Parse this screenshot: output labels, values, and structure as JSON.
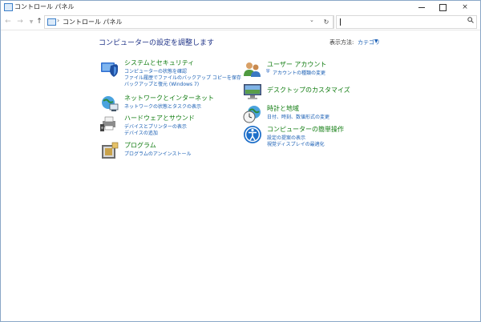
{
  "window": {
    "title": "コントロール パネル",
    "controls": {
      "minimize": "minimize",
      "maximize": "maximize",
      "close": "×"
    }
  },
  "address_bar": {
    "path": "コントロール パネル",
    "separator": "›",
    "search_value": ""
  },
  "main": {
    "heading": "コンピューターの設定を調整します",
    "view_by_label": "表示方法:",
    "view_by_value": "カテゴリ"
  },
  "categories_left": [
    {
      "title": "システムとセキュリティ",
      "icon": "shield-computer-icon",
      "links": [
        "コンピューターの状態を確認",
        "ファイル履歴でファイルのバックアップ コピーを保存",
        "バックアップと復元 (Windows 7)"
      ]
    },
    {
      "title": "ネットワークとインターネット",
      "icon": "network-globe-icon",
      "links": [
        "ネットワークの状態とタスクの表示"
      ]
    },
    {
      "title": "ハードウェアとサウンド",
      "icon": "printer-speaker-icon",
      "links": [
        "デバイスとプリンターの表示",
        "デバイスの追加"
      ]
    },
    {
      "title": "プログラム",
      "icon": "programs-box-icon",
      "links": [
        "プログラムのアンインストール"
      ]
    }
  ],
  "categories_right": [
    {
      "title": "ユーザー アカウント",
      "icon": "users-icon",
      "links": [
        "アカウントの種類の変更"
      ]
    },
    {
      "title": "デスクトップのカスタマイズ",
      "icon": "desktop-monitor-icon",
      "links": []
    },
    {
      "title": "時計と地域",
      "icon": "clock-globe-icon",
      "links": [
        "日付、時刻、数値形式の変更"
      ]
    },
    {
      "title": "コンピューターの簡単操作",
      "icon": "ease-of-access-icon",
      "links": [
        "設定の提案の表示",
        "視覚ディスプレイの最適化"
      ]
    }
  ],
  "colors": {
    "category_title": "#107c10",
    "link": "#1a5fb4",
    "heading": "#1e3287"
  }
}
